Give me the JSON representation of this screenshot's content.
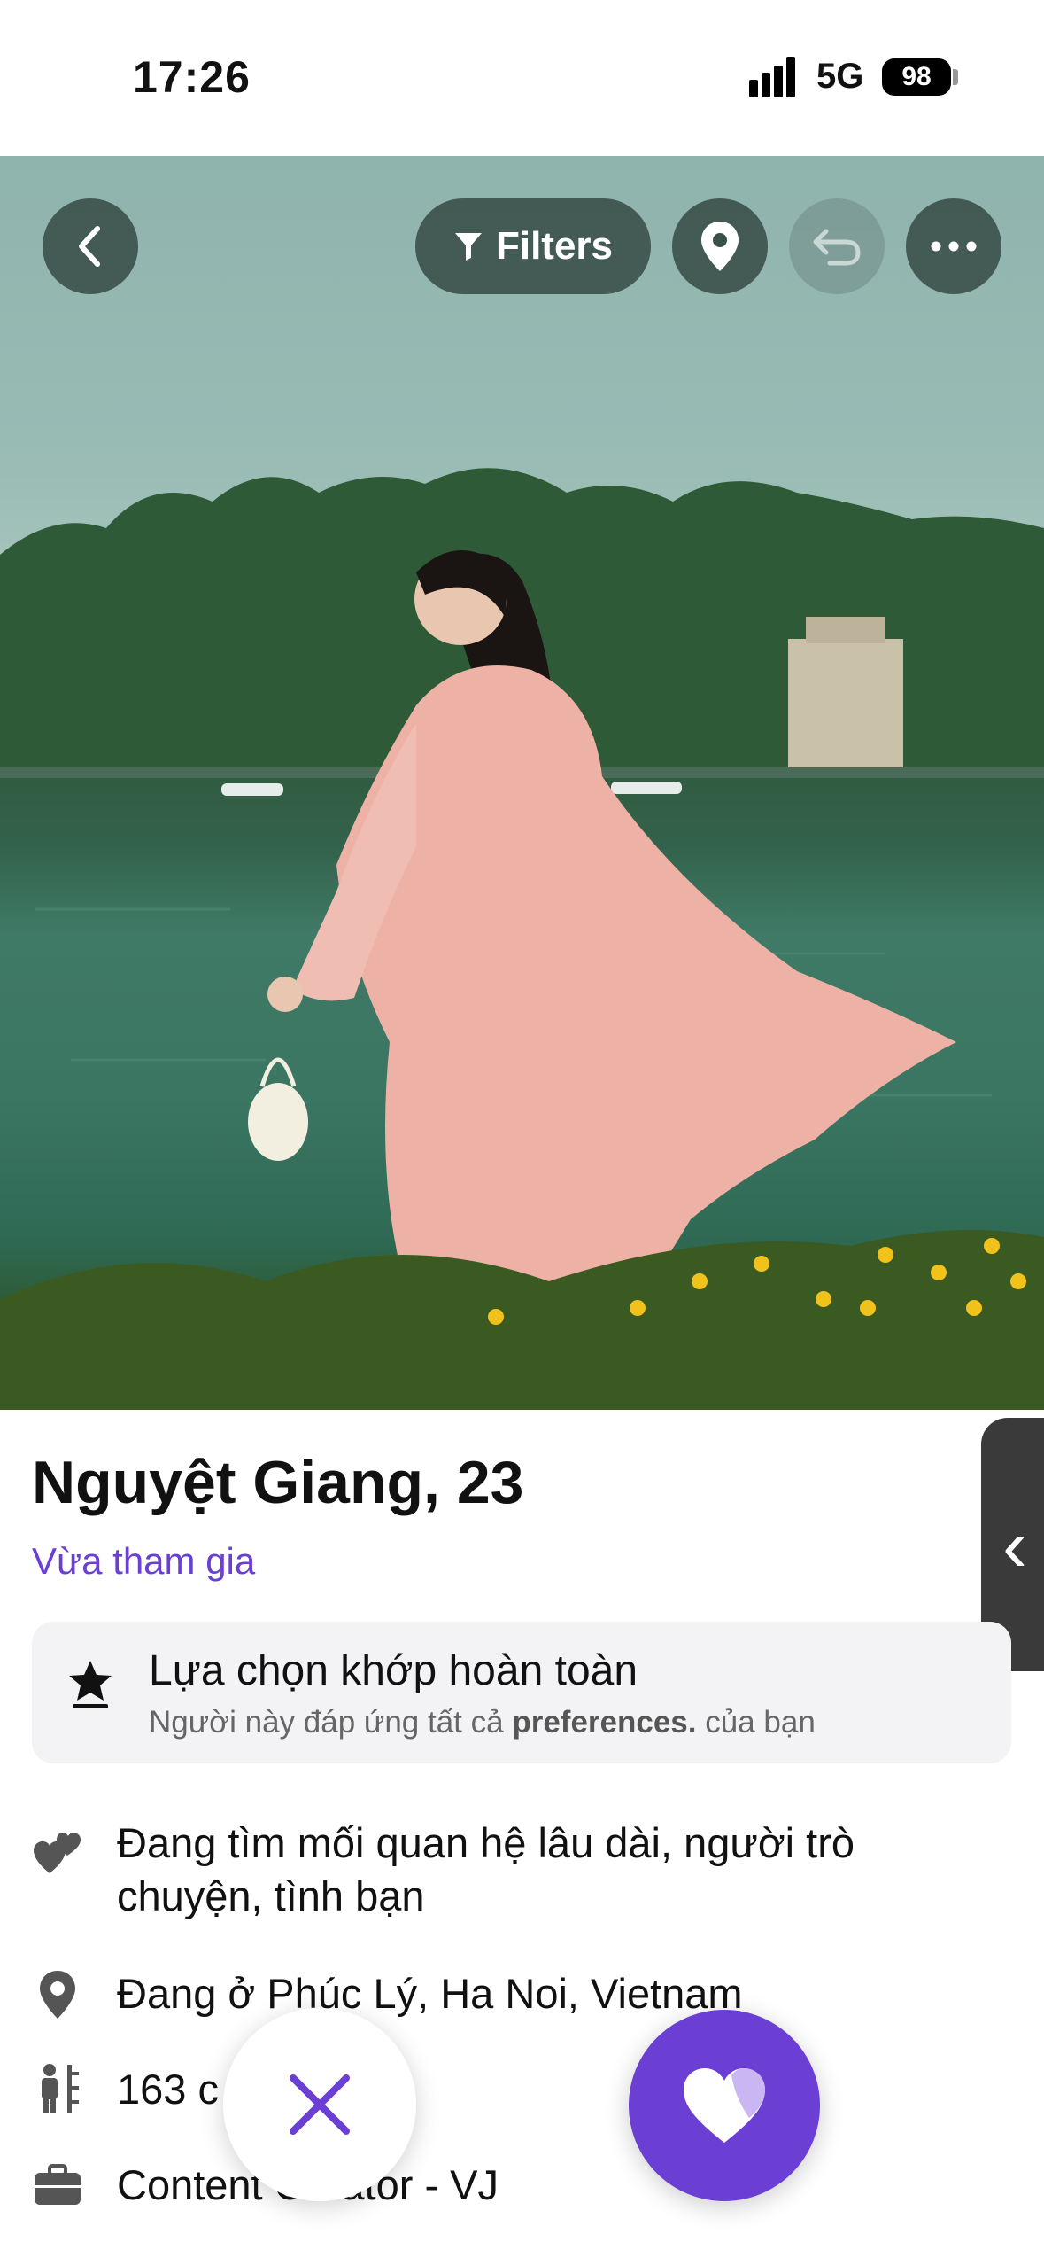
{
  "status_bar": {
    "time": "17:26",
    "network": "5G",
    "battery": "98"
  },
  "toolbar": {
    "filters_label": "Filters"
  },
  "profile": {
    "name_age": "Nguyệt Giang, 23",
    "joined": "Vừa tham gia",
    "match": {
      "title": "Lựa chọn khớp hoàn toàn",
      "subtitle_pre": "Người này đáp ứng tất cả",
      "subtitle_bold": "preferences.",
      "subtitle_post": "của bạn"
    },
    "details": [
      {
        "icon": "hearts-icon",
        "text": "Đang tìm mối quan hệ lâu dài, người trò chuyện, tình bạn"
      },
      {
        "icon": "location-pin-icon",
        "text": "Đang ở Phúc Lý, Ha Noi, Vietnam"
      },
      {
        "icon": "height-icon",
        "text": "163 c"
      },
      {
        "icon": "briefcase-icon",
        "text": "Content Creator - VJ"
      }
    ]
  },
  "colors": {
    "accent": "#6b3fd3",
    "link": "#6a3fd6",
    "toolbar_bg": "#32463f"
  }
}
